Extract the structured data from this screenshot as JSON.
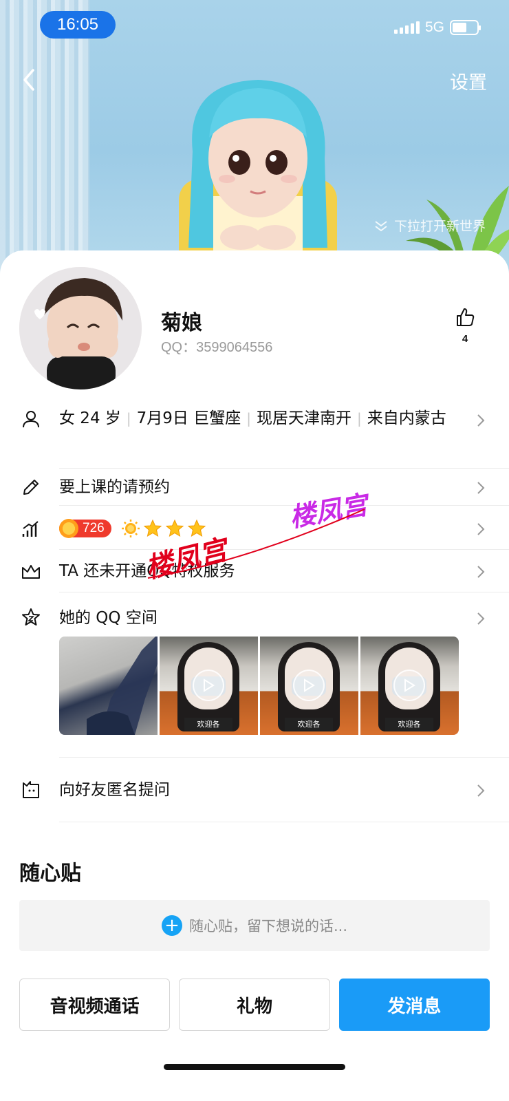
{
  "status_bar": {
    "time": "16:05",
    "network": "5G",
    "battery_level": 0.6
  },
  "header": {
    "settings_label": "设置",
    "pull_hint": "下拉打开新世界"
  },
  "profile": {
    "nickname": "菊娘",
    "qq_label": "QQ：",
    "qq_number": "3599064556",
    "like_count": "4"
  },
  "info_rows": {
    "basic": {
      "gender_age": "女 24 岁",
      "birthday": "7月9日 巨蟹座",
      "location": "现居天津南开",
      "hometown": "来自内蒙古"
    },
    "signature": "要上课的请预约",
    "level": {
      "value": "726",
      "stars": 4
    },
    "vip": "TA 还未开通QQ特权服务",
    "qzone": "她的 QQ 空间",
    "ask": "向好友匿名提问"
  },
  "qzone_photos": [
    {
      "kind": "photo"
    },
    {
      "kind": "video",
      "sign": "欢迎各"
    },
    {
      "kind": "video",
      "sign": "欢迎各"
    },
    {
      "kind": "video",
      "sign": "欢迎各"
    }
  ],
  "notes": {
    "title": "随心贴",
    "placeholder": "随心贴，留下想说的话..."
  },
  "actions": {
    "call": "音视频通话",
    "gift": "礼物",
    "message": "发消息"
  },
  "watermark": "楼凤宫",
  "colors": {
    "accent": "#1a9bf7",
    "level_badge": "#ef3a2c",
    "time_pill": "#1a73e8"
  }
}
